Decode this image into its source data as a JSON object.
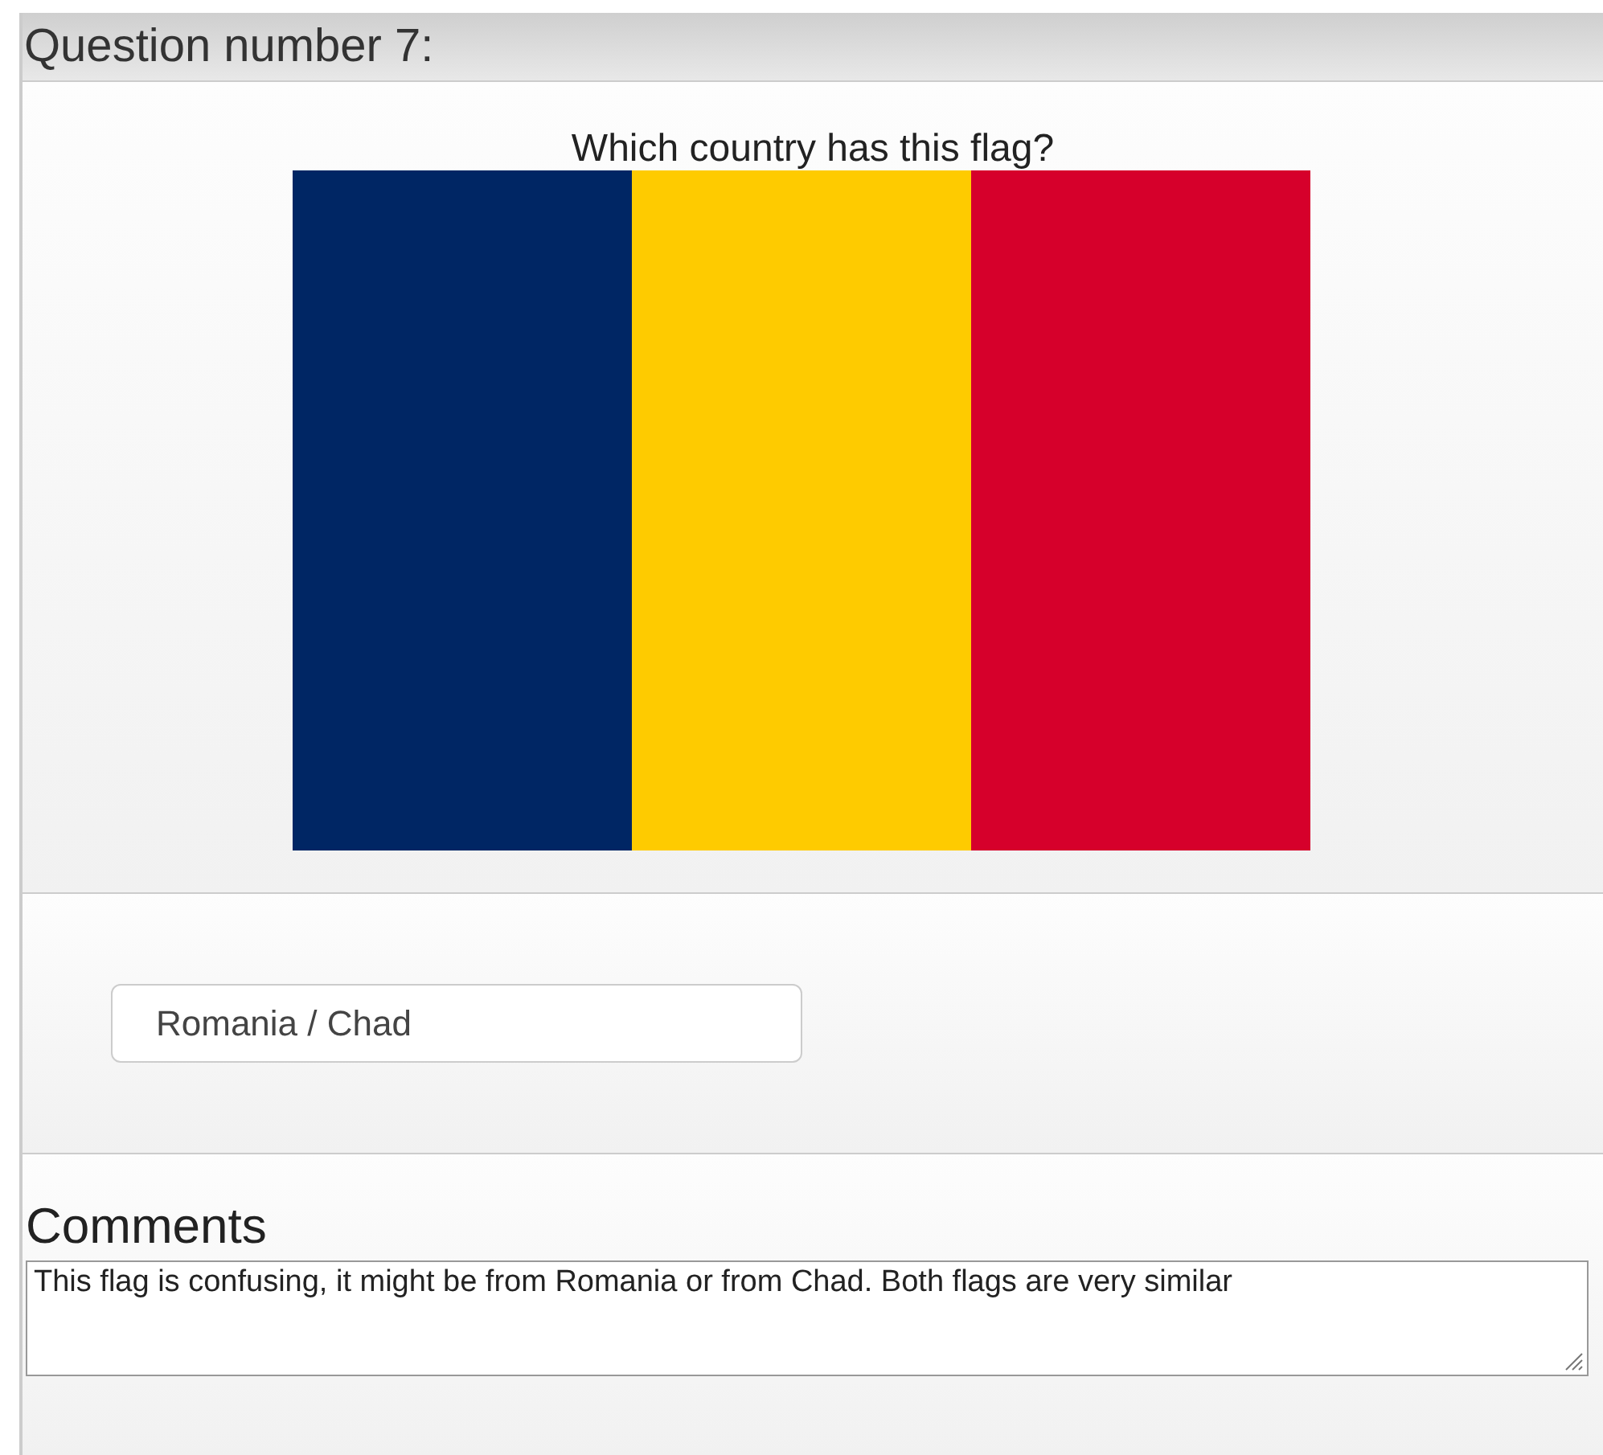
{
  "question": {
    "title": "Question number 7:",
    "prompt": "Which country has this flag?",
    "flag": {
      "stripes": [
        {
          "color": "#002664"
        },
        {
          "color": "#fecb00"
        },
        {
          "color": "#d6002b"
        }
      ]
    }
  },
  "answer": {
    "value": "Romania / Chad"
  },
  "comments": {
    "label": "Comments",
    "value": "This flag is confusing, it might be from Romania or from Chad. Both flags are very similar"
  }
}
